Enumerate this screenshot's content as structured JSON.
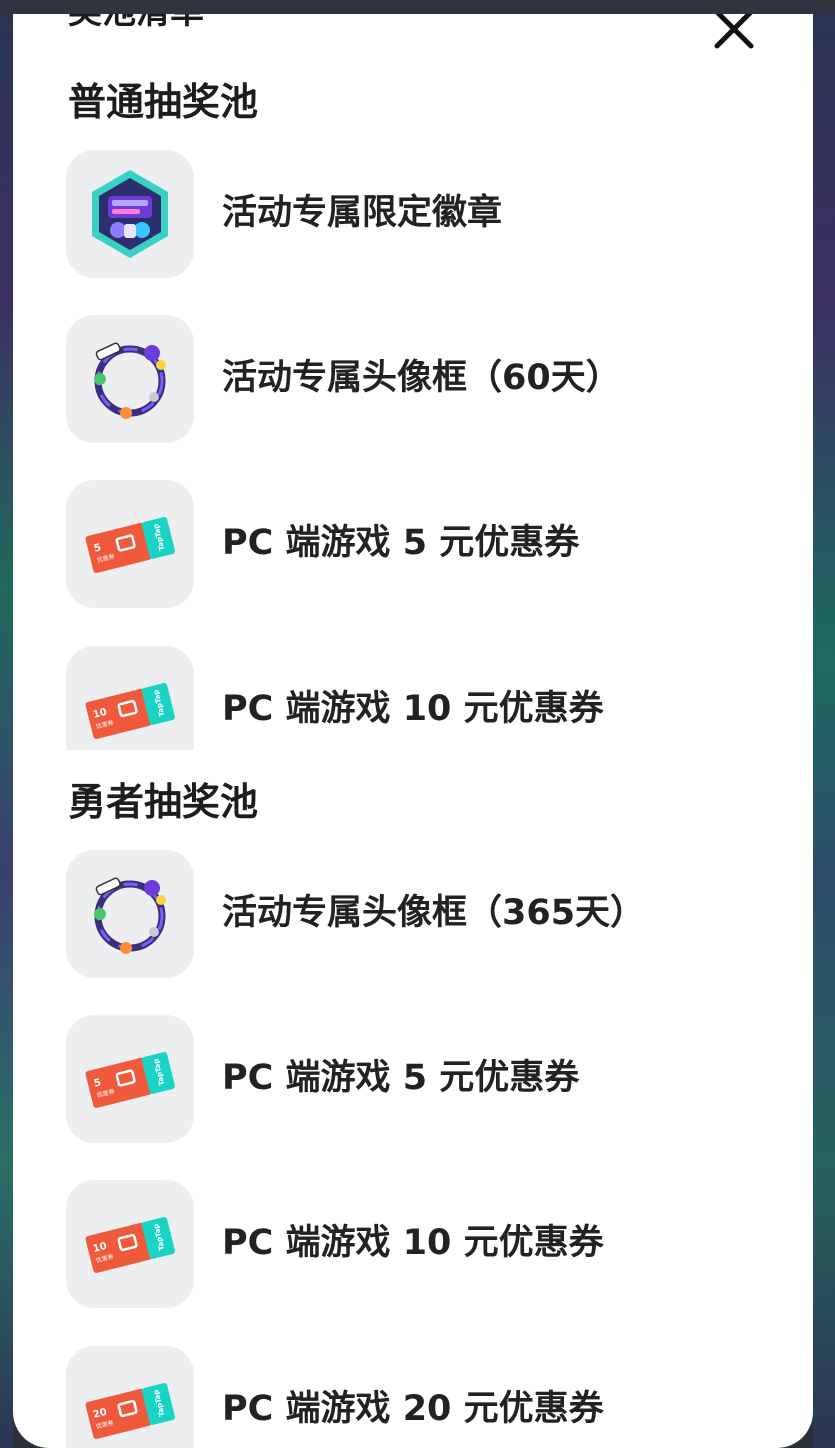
{
  "modal": {
    "title": "奖池清单",
    "close_icon": "close-icon"
  },
  "pools": [
    {
      "title": "普通抽奖池",
      "items": [
        {
          "label": "活动专属限定徽章",
          "icon": "badge-icon"
        },
        {
          "label": "活动专属头像框（60天）",
          "icon": "avatar-frame-icon"
        },
        {
          "label": "PC 端游戏 5 元优惠券",
          "icon": "coupon-icon",
          "coupon_amount": "5"
        },
        {
          "label": "PC 端游戏 10 元优惠券",
          "icon": "coupon-icon",
          "coupon_amount": "10"
        }
      ]
    },
    {
      "title": "勇者抽奖池",
      "items": [
        {
          "label": "活动专属头像框（365天）",
          "icon": "avatar-frame-icon"
        },
        {
          "label": "PC 端游戏 5 元优惠券",
          "icon": "coupon-icon",
          "coupon_amount": "5"
        },
        {
          "label": "PC 端游戏 10 元优惠券",
          "icon": "coupon-icon",
          "coupon_amount": "10"
        },
        {
          "label": "PC 端游戏 20 元优惠券",
          "icon": "coupon-icon",
          "coupon_amount": "20"
        }
      ]
    }
  ],
  "coupon": {
    "unit": "元",
    "caption": "优惠券",
    "brand": "TapTap"
  },
  "colors": {
    "background": "#ffffff",
    "thumb_bg": "#eceeef",
    "coupon_orange": "#f05a3c",
    "coupon_teal": "#19d3c5",
    "frame_purple": "#5a3fd0"
  }
}
